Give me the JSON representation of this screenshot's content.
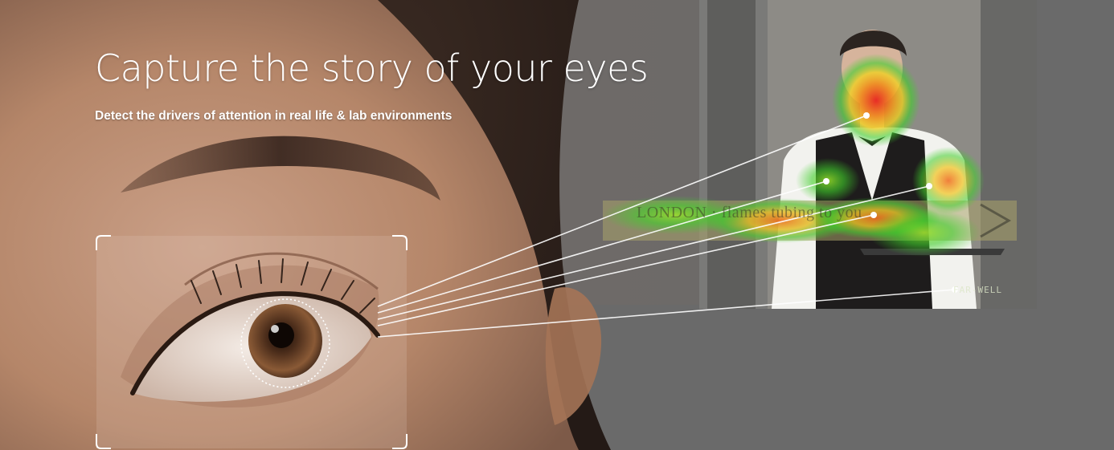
{
  "hero": {
    "title": "Capture the story of your eyes",
    "subtitle": "Detect the drivers of attention in real life & lab environments"
  },
  "scene": {
    "banner_text": "LONDON · flames tubing to you",
    "sign_text": "FAR-WELL"
  },
  "palette": {
    "heat_high": "#e8251f",
    "heat_mid": "#f2d21b",
    "heat_low": "#3fcf2a",
    "gaze_line": "#ffffff",
    "skin": "#b98a6e",
    "backdrop": "#6d6d6d"
  },
  "icons": [
    "focus-frame-icon",
    "pupil-target-icon",
    "gaze-point-icon"
  ]
}
